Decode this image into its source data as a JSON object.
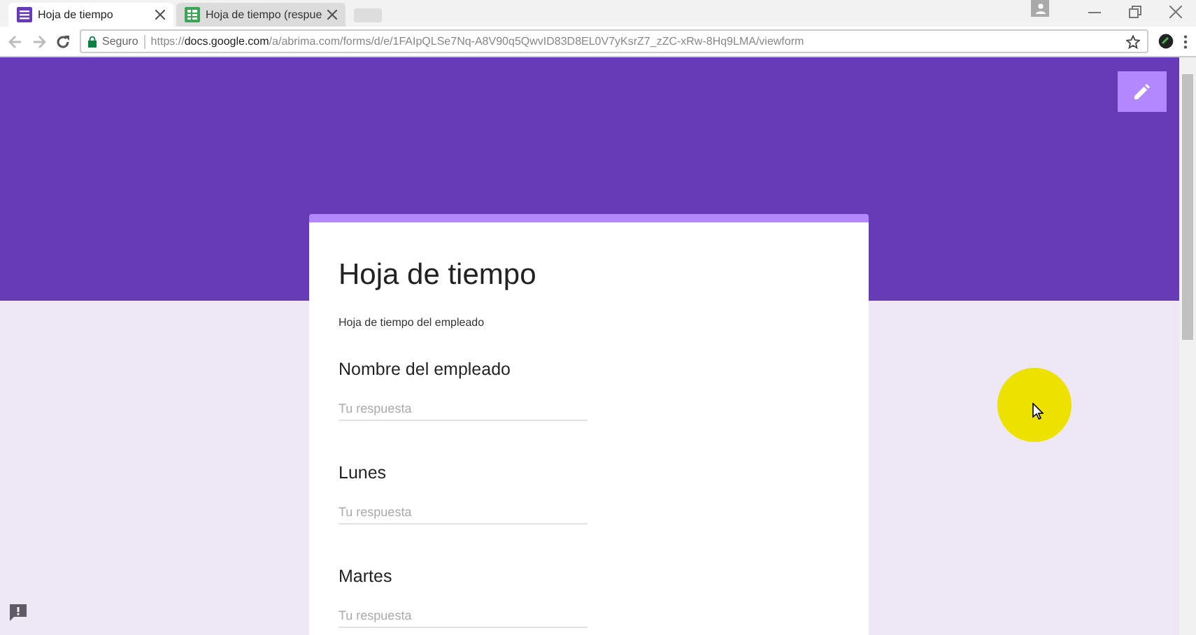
{
  "browser": {
    "tabs": [
      {
        "label": "Hoja de tiempo",
        "kind": "form",
        "selected": true
      },
      {
        "label": "Hoja de tiempo (respue",
        "kind": "sheet",
        "selected": false
      }
    ],
    "security": "Seguro",
    "url": "https://**docs.google.com**/a/abrima.com/forms/d/e/1FAIpQLSe7Nq-A8V90q5QwvID83D8EL0V7yKsrZ7_zZC-xRw-8Hq9LMA/viewform"
  },
  "form": {
    "title": "Hoja de tiempo",
    "description": "Hoja de tiempo del empleado",
    "questions": [
      {
        "title": "Nombre del empleado",
        "placeholder": "Tu respuesta"
      },
      {
        "title": "Lunes",
        "placeholder": "Tu respuesta"
      },
      {
        "title": "Martes",
        "placeholder": "Tu respuesta"
      }
    ]
  }
}
